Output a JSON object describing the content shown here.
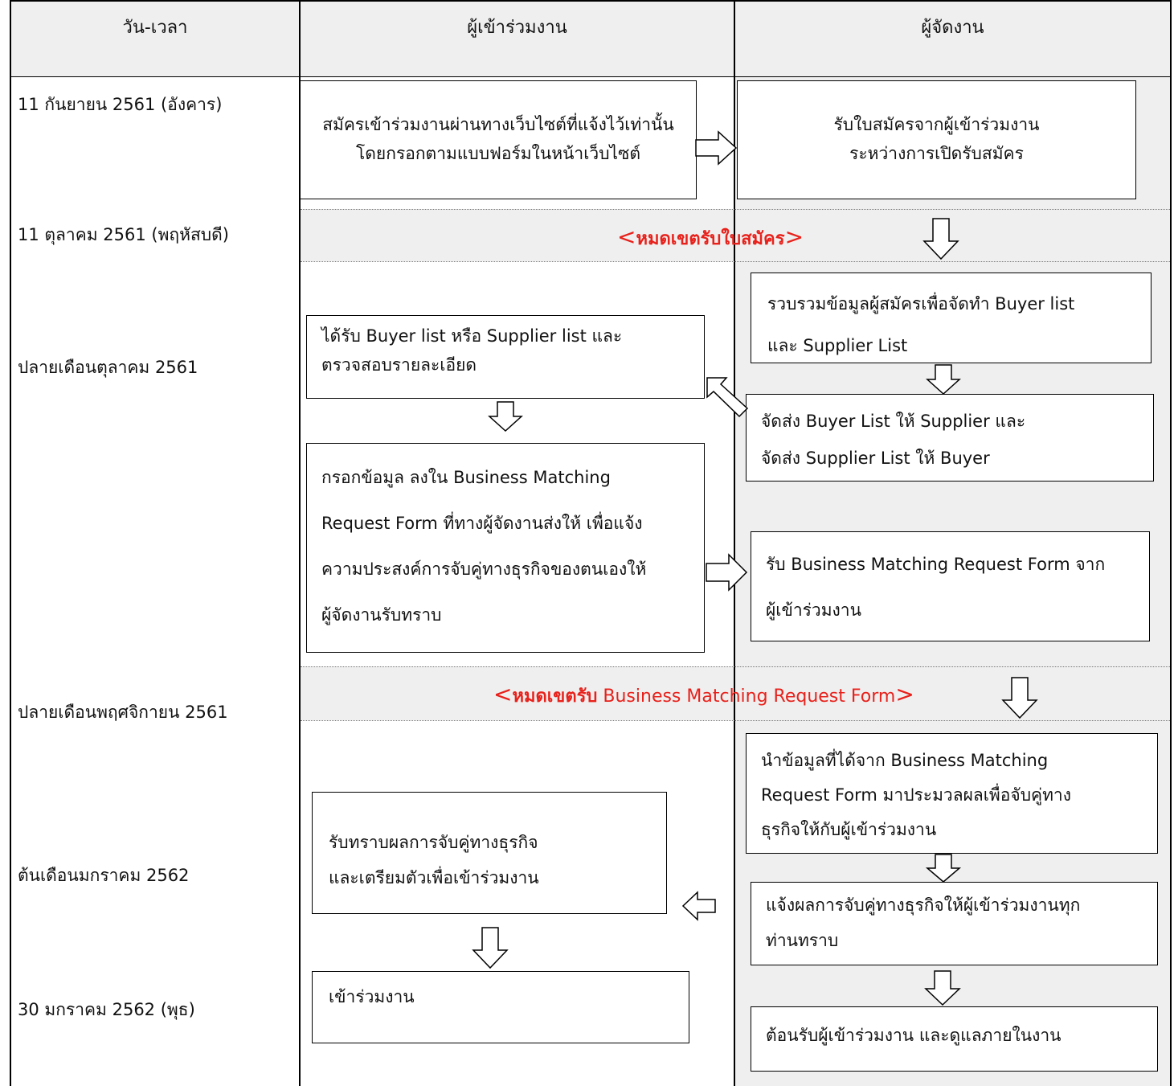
{
  "header": {
    "col_datetime": "วัน-เวลา",
    "col_participant": "ผู้เข้าร่วมงาน",
    "col_organizer": "ผู้จัดงาน"
  },
  "dates": [
    "11 กันยายน 2561 (อังคาร)",
    "11 ตุลาคม 2561 (พฤหัสบดี)",
    "ปลายเดือนตุลาคม 2561",
    "ปลายเดือนพฤศจิกายน 2561",
    "ต้นเดือนมกราคม 2562",
    "30 มกราคม 2562 (พุธ)"
  ],
  "participant_steps": [
    [
      "สมัครเข้าร่วมงานผ่านทางเว็บไซต์ที่แจ้งไว้เท่านั้น",
      "โดยกรอกตามแบบฟอร์มในหน้าเว็บไซต์"
    ],
    [
      "ได้รับ Buyer list หรือ Supplier list และ",
      "ตรวจสอบรายละเอียด"
    ],
    [
      "กรอกข้อมูล ลงใน  Business Matching",
      "Request Form ที่ทางผู้จัดงานส่งให้ เพื่อแจ้ง",
      "ความประสงค์การจับคู่ทางธุรกิจของตนเองให้",
      "ผู้จัดงานรับทราบ"
    ],
    [
      "รับทราบผลการจับคู่ทางธุรกิจ",
      "และเตรียมตัวเพื่อเข้าร่วมงาน"
    ],
    [
      "เข้าร่วมงาน"
    ]
  ],
  "organizer_steps": [
    [
      "รับใบสมัครจากผู้เข้าร่วมงาน",
      "ระหว่างการเปิดรับสมัคร"
    ],
    [
      "รวบรวมข้อมูลผู้สมัครเพื่อจัดทำ Buyer list",
      "และ Supplier List"
    ],
    [
      "จัดส่ง Buyer List ให้ Supplier  และ",
      "จัดส่ง Supplier List  ให้ Buyer"
    ],
    [
      "รับ Business Matching Request Form จาก",
      "ผู้เข้าร่วมงาน"
    ],
    [
      "นำข้อมูลที่ได้จาก Business Matching",
      "Request Form มาประมวลผลเพื่อจับคู่ทาง",
      "ธุรกิจให้กับผู้เข้าร่วมงาน"
    ],
    [
      "แจ้งผลการจับคู่ทางธุรกิจให้ผู้เข้าร่วมงานทุก",
      "ท่านทราบ"
    ],
    [
      "ต้อนรับผู้เข้าร่วมงาน และดูแลภายในงาน"
    ]
  ],
  "deadlines": {
    "application": {
      "open": "<",
      "text": "หมดเขตรับใบสมัคร",
      "close": ">"
    },
    "request_form": {
      "open": "<",
      "text_bold": "หมดเขตรับ",
      "text_rest": " Business Matching Request Form",
      "close": ">"
    }
  },
  "colors": {
    "deadline_text": "#e8211b",
    "shaded_background": "#efefef",
    "border": "#000000"
  }
}
